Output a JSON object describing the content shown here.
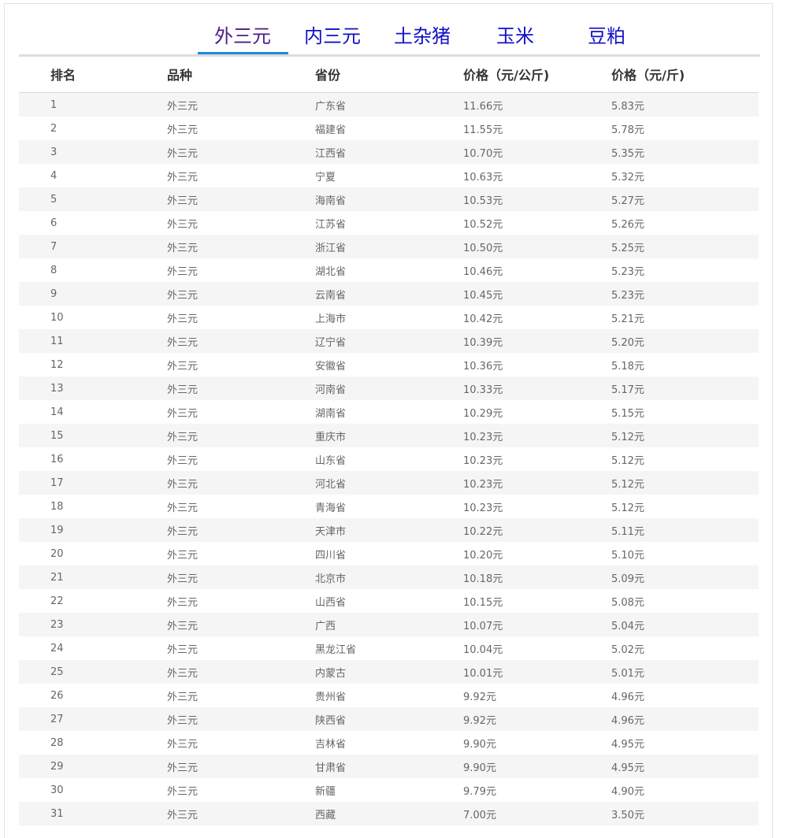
{
  "tabs": [
    {
      "label": "外三元",
      "active": true
    },
    {
      "label": "内三元",
      "active": false
    },
    {
      "label": "土杂猪",
      "active": false
    },
    {
      "label": "玉米",
      "active": false
    },
    {
      "label": "豆粕",
      "active": false
    }
  ],
  "colors": {
    "active_tab_text": "#4b1b86",
    "tab_text": "#1010c8",
    "active_tab_underline": "#1d8ad8",
    "row_stripe": "#f5f5f5"
  },
  "table": {
    "headers": [
      "排名",
      "品种",
      "省份",
      "价格（元/公斤)",
      "价格（元/斤)"
    ],
    "rows": [
      [
        "1",
        "外三元",
        "广东省",
        "11.66元",
        "5.83元"
      ],
      [
        "2",
        "外三元",
        "福建省",
        "11.55元",
        "5.78元"
      ],
      [
        "3",
        "外三元",
        "江西省",
        "10.70元",
        "5.35元"
      ],
      [
        "4",
        "外三元",
        "宁夏",
        "10.63元",
        "5.32元"
      ],
      [
        "5",
        "外三元",
        "海南省",
        "10.53元",
        "5.27元"
      ],
      [
        "6",
        "外三元",
        "江苏省",
        "10.52元",
        "5.26元"
      ],
      [
        "7",
        "外三元",
        "浙江省",
        "10.50元",
        "5.25元"
      ],
      [
        "8",
        "外三元",
        "湖北省",
        "10.46元",
        "5.23元"
      ],
      [
        "9",
        "外三元",
        "云南省",
        "10.45元",
        "5.23元"
      ],
      [
        "10",
        "外三元",
        "上海市",
        "10.42元",
        "5.21元"
      ],
      [
        "11",
        "外三元",
        "辽宁省",
        "10.39元",
        "5.20元"
      ],
      [
        "12",
        "外三元",
        "安徽省",
        "10.36元",
        "5.18元"
      ],
      [
        "13",
        "外三元",
        "河南省",
        "10.33元",
        "5.17元"
      ],
      [
        "14",
        "外三元",
        "湖南省",
        "10.29元",
        "5.15元"
      ],
      [
        "15",
        "外三元",
        "重庆市",
        "10.23元",
        "5.12元"
      ],
      [
        "16",
        "外三元",
        "山东省",
        "10.23元",
        "5.12元"
      ],
      [
        "17",
        "外三元",
        "河北省",
        "10.23元",
        "5.12元"
      ],
      [
        "18",
        "外三元",
        "青海省",
        "10.23元",
        "5.12元"
      ],
      [
        "19",
        "外三元",
        "天津市",
        "10.22元",
        "5.11元"
      ],
      [
        "20",
        "外三元",
        "四川省",
        "10.20元",
        "5.10元"
      ],
      [
        "21",
        "外三元",
        "北京市",
        "10.18元",
        "5.09元"
      ],
      [
        "22",
        "外三元",
        "山西省",
        "10.15元",
        "5.08元"
      ],
      [
        "23",
        "外三元",
        "广西",
        "10.07元",
        "5.04元"
      ],
      [
        "24",
        "外三元",
        "黑龙江省",
        "10.04元",
        "5.02元"
      ],
      [
        "25",
        "外三元",
        "内蒙古",
        "10.01元",
        "5.01元"
      ],
      [
        "26",
        "外三元",
        "贵州省",
        "9.92元",
        "4.96元"
      ],
      [
        "27",
        "外三元",
        "陕西省",
        "9.92元",
        "4.96元"
      ],
      [
        "28",
        "外三元",
        "吉林省",
        "9.90元",
        "4.95元"
      ],
      [
        "29",
        "外三元",
        "甘肃省",
        "9.90元",
        "4.95元"
      ],
      [
        "30",
        "外三元",
        "新疆",
        "9.79元",
        "4.90元"
      ],
      [
        "31",
        "外三元",
        "西藏",
        "7.00元",
        "3.50元"
      ]
    ]
  }
}
